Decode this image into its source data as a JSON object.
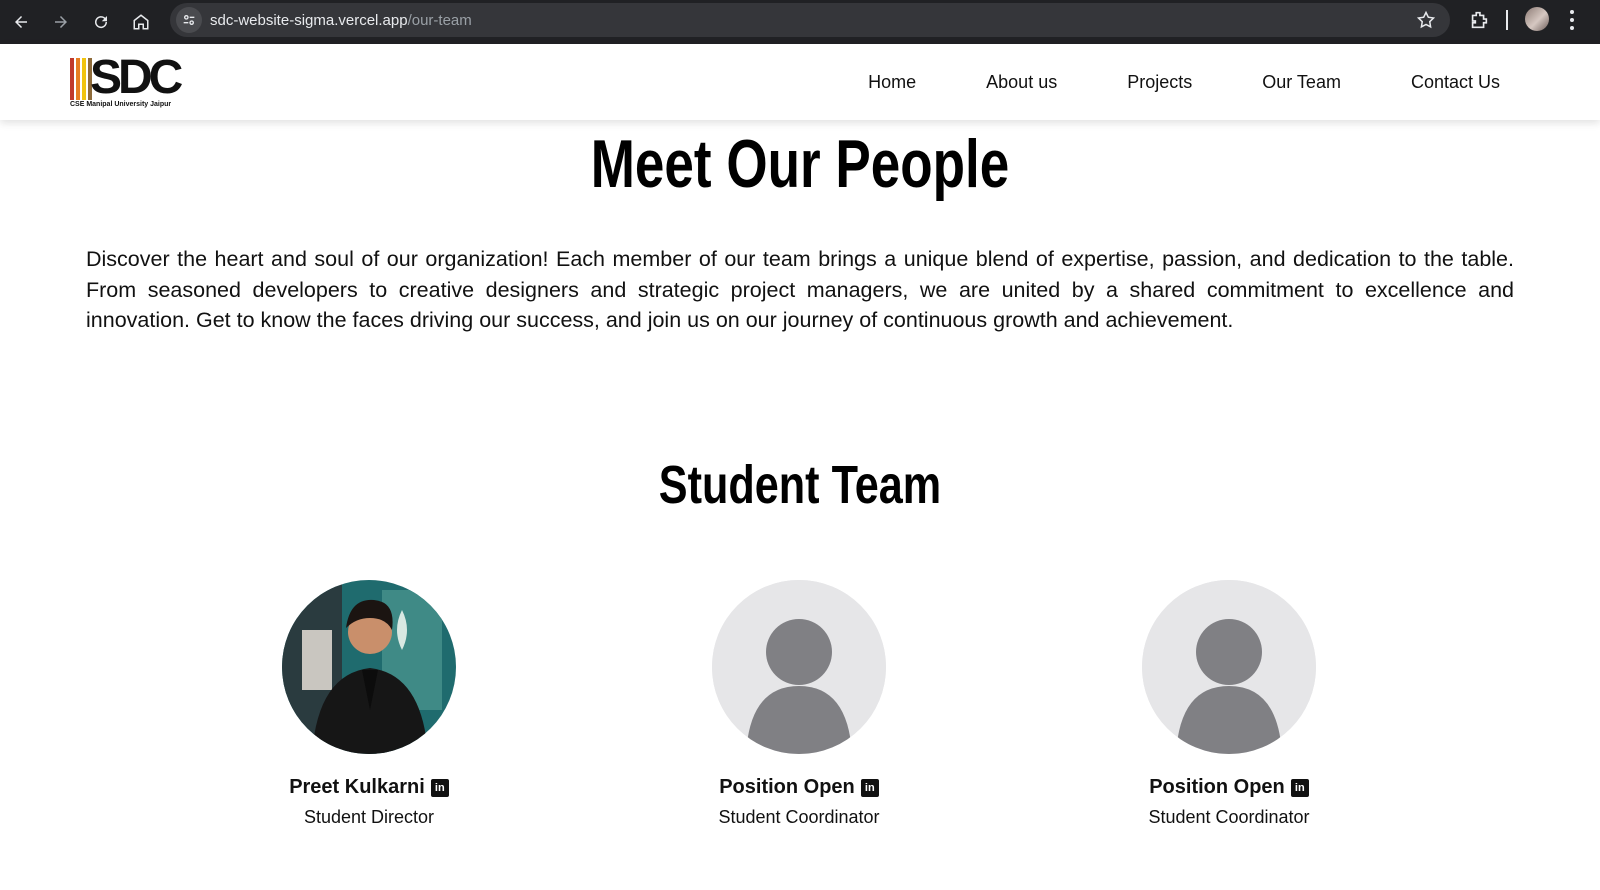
{
  "browser": {
    "url_domain": "sdc-website-sigma.vercel.app",
    "url_path": "/our-team"
  },
  "site": {
    "logo_text": "SDC",
    "logo_tagline": "CSE Manipal University Jaipur",
    "logo_bar_colors": [
      "#c0392b",
      "#e67e22",
      "#f1c40f",
      "#8e6b3a"
    ],
    "nav": [
      {
        "label": "Home"
      },
      {
        "label": "About us"
      },
      {
        "label": "Projects"
      },
      {
        "label": "Our Team"
      },
      {
        "label": "Contact Us"
      }
    ]
  },
  "hero": {
    "title": "Meet Our People",
    "intro": "Discover the heart and soul of our organization! Each member of our team brings a unique blend of expertise, passion, and dedication to the table. From seasoned developers to creative designers and strategic project managers, we are united by a shared commitment to excellence and innovation. Get to know the faces driving our success, and join us on our journey of continuous growth and achievement."
  },
  "student_team": {
    "title": "Student Team",
    "members": [
      {
        "name": "Preet Kulkarni",
        "role": "Student Director",
        "photo": "person-photo",
        "link_icon": "linkedin-icon"
      },
      {
        "name": "Position Open",
        "role": "Student Coordinator",
        "photo": "placeholder-avatar",
        "link_icon": "linkedin-icon"
      },
      {
        "name": "Position Open",
        "role": "Student Coordinator",
        "photo": "placeholder-avatar",
        "link_icon": "linkedin-icon"
      }
    ]
  },
  "colors": {
    "chrome_bg": "#202124",
    "omnibox_bg": "#35363a",
    "placeholder_bg": "#e6e6e8",
    "placeholder_figure": "#808084"
  }
}
